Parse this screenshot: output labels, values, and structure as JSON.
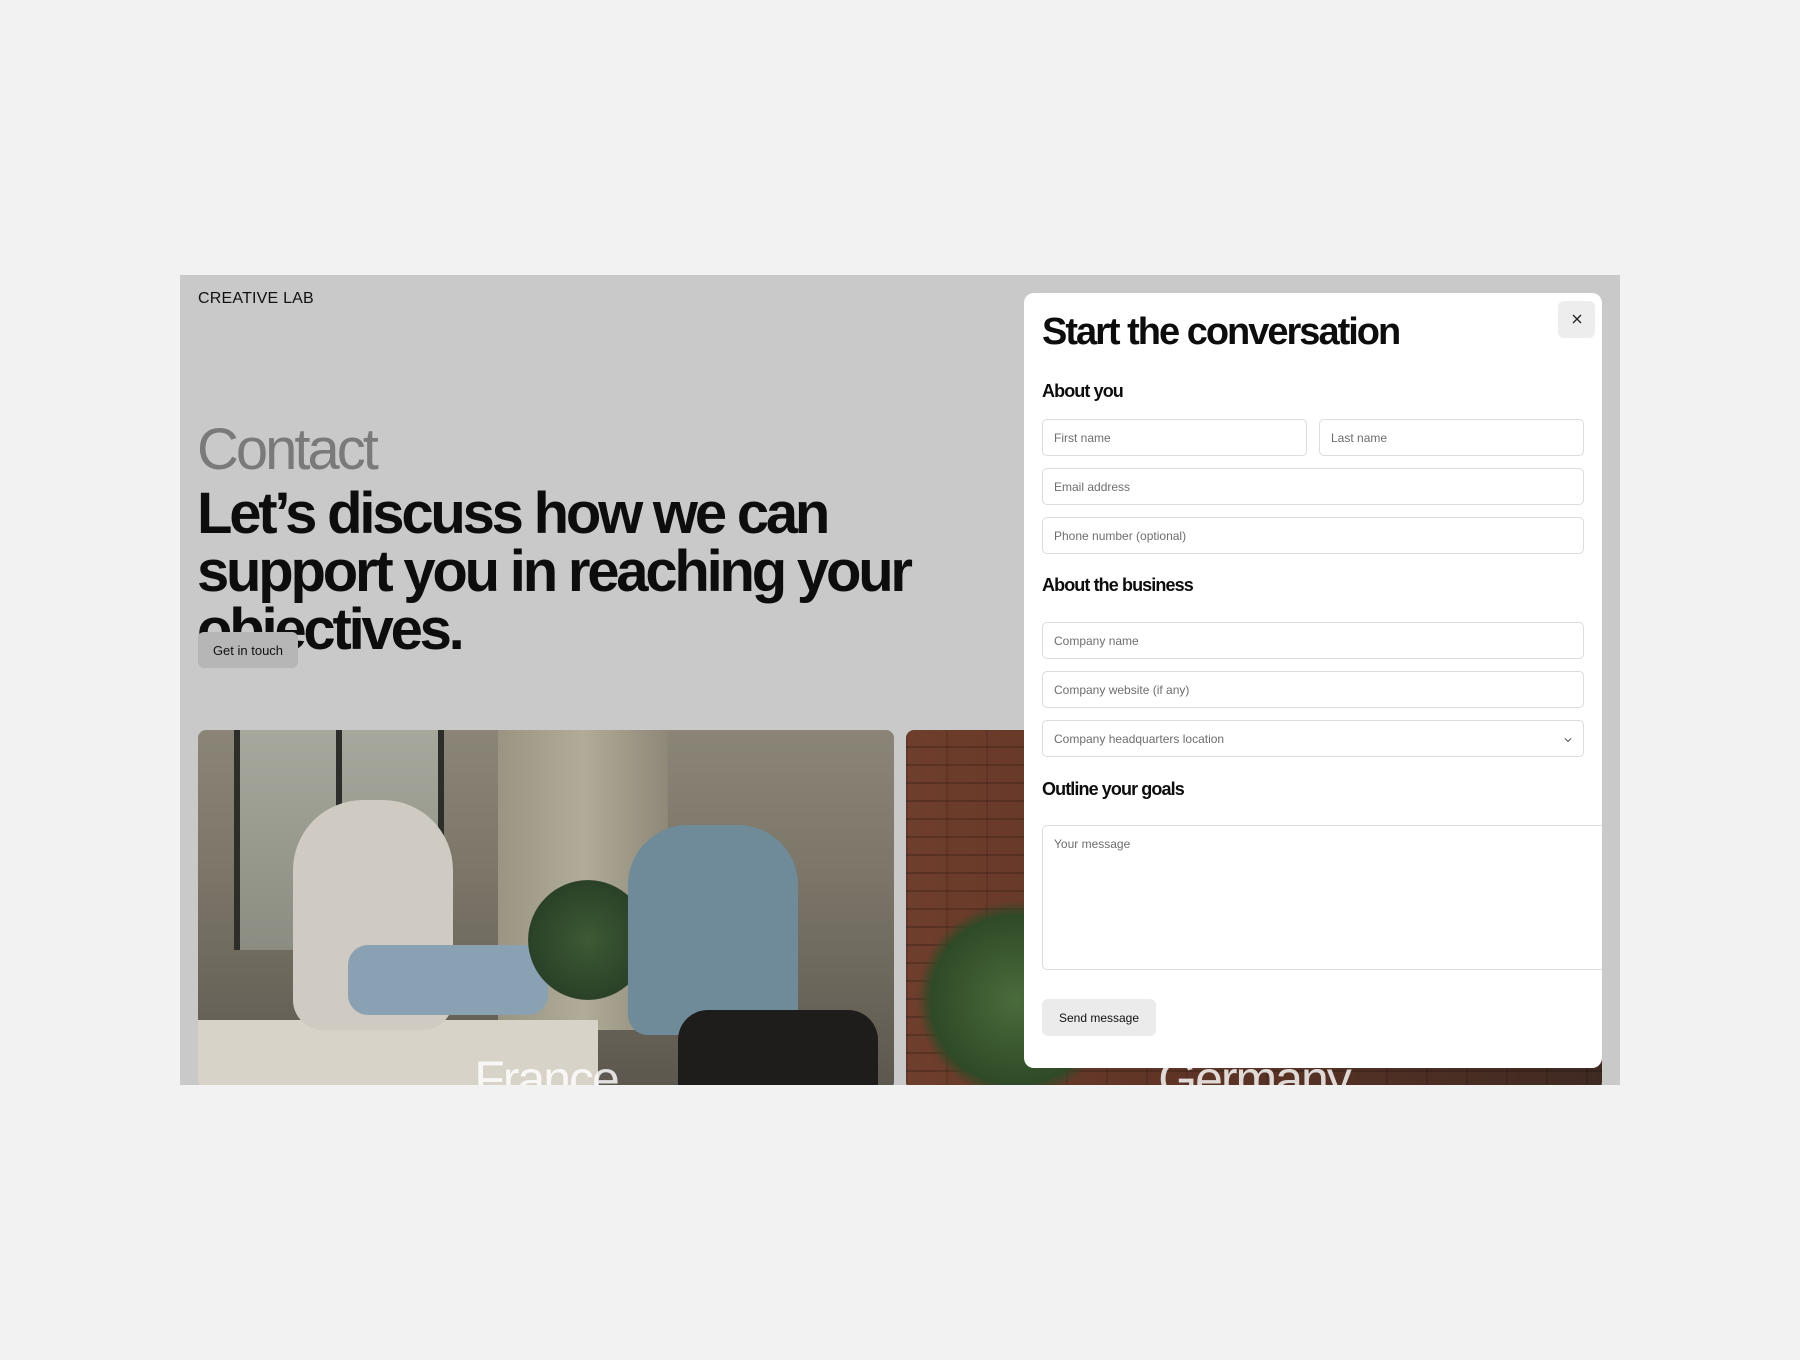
{
  "site": {
    "brand": "CREATIVE LAB"
  },
  "hero": {
    "eyebrow": "Contact",
    "headline": "Let’s discuss how we can support you in reaching your objectives.",
    "cta_label": "Get in touch"
  },
  "locations": [
    {
      "label": "France"
    },
    {
      "label": "Germany"
    }
  ],
  "modal": {
    "title": "Start the conversation",
    "close_icon": "close-icon",
    "sections": {
      "about_you": "About you",
      "about_business": "About the business",
      "goals": "Outline your goals"
    },
    "fields": {
      "first_name": {
        "placeholder": "First name",
        "value": ""
      },
      "last_name": {
        "placeholder": "Last name",
        "value": ""
      },
      "email": {
        "placeholder": "Email address",
        "value": ""
      },
      "phone": {
        "placeholder": "Phone number (optional)",
        "value": ""
      },
      "company_name": {
        "placeholder": "Company name",
        "value": ""
      },
      "company_website": {
        "placeholder": "Company website (if any)",
        "value": ""
      },
      "hq_location": {
        "placeholder": "Company headquarters location",
        "value": ""
      },
      "message": {
        "placeholder": "Your message",
        "value": ""
      }
    },
    "submit_label": "Send message"
  }
}
